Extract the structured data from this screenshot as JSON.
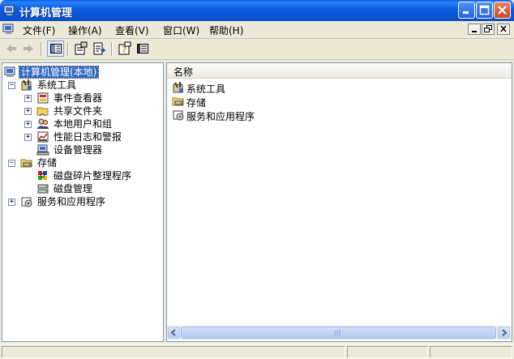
{
  "window": {
    "title": "计算机管理"
  },
  "menu": {
    "items": [
      {
        "label": "文件(F)"
      },
      {
        "label": "操作(A)"
      },
      {
        "label": "查看(V)"
      },
      {
        "label": "窗口(W)"
      },
      {
        "label": "帮助(H)"
      }
    ]
  },
  "tree": {
    "root": {
      "label": "计算机管理(本地)"
    },
    "system_tools": {
      "label": "系统工具"
    },
    "event_viewer": {
      "label": "事件查看器"
    },
    "shared_folders": {
      "label": "共享文件夹"
    },
    "local_users": {
      "label": "本地用户和组"
    },
    "perf_logs": {
      "label": "性能日志和警报"
    },
    "device_manager": {
      "label": "设备管理器"
    },
    "storage": {
      "label": "存储"
    },
    "defrag": {
      "label": "磁盘碎片整理程序"
    },
    "disk_mgmt": {
      "label": "磁盘管理"
    },
    "services_apps": {
      "label": "服务和应用程序"
    }
  },
  "list": {
    "column_name": "名称",
    "rows": [
      {
        "label": "系统工具"
      },
      {
        "label": "存储"
      },
      {
        "label": "服务和应用程序"
      }
    ]
  },
  "colors": {
    "titlebar": "#0a54d4",
    "selection": "#316ac5",
    "window_bg": "#ece9d8"
  }
}
